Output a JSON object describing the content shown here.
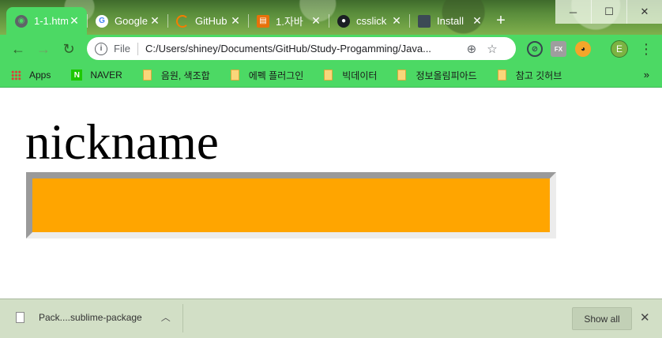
{
  "tabs": [
    {
      "title": "1-1.htm",
      "icon": "globe-icon",
      "active": true
    },
    {
      "title": "Google",
      "icon": "google-icon"
    },
    {
      "title": "GitHub",
      "icon": "spinner-icon"
    },
    {
      "title": "1.자바",
      "icon": "book-icon"
    },
    {
      "title": "csslick",
      "icon": "github-icon"
    },
    {
      "title": "Install",
      "icon": "page-icon"
    }
  ],
  "window_controls": {
    "minimize": "─",
    "maximize": "☐",
    "close": "✕"
  },
  "toolbar": {
    "scheme": "File",
    "url": "C:/Users/shiney/Documents/GitHub/Study-Progamming/Java...",
    "avatar_letter": "E"
  },
  "bookmarks": [
    {
      "label": "Apps",
      "kind": "apps"
    },
    {
      "label": "NAVER",
      "kind": "naver"
    },
    {
      "label": "음원, 색조합",
      "kind": "folder"
    },
    {
      "label": "에펙 플러그인",
      "kind": "folder"
    },
    {
      "label": "빅데이터",
      "kind": "folder"
    },
    {
      "label": "정보올림피아드",
      "kind": "folder"
    },
    {
      "label": "참고 깃허브",
      "kind": "folder"
    }
  ],
  "page": {
    "heading": "nickname",
    "box_color": "#ffa500"
  },
  "shelf": {
    "filename": "Pack....sublime-package",
    "show_all": "Show all"
  }
}
